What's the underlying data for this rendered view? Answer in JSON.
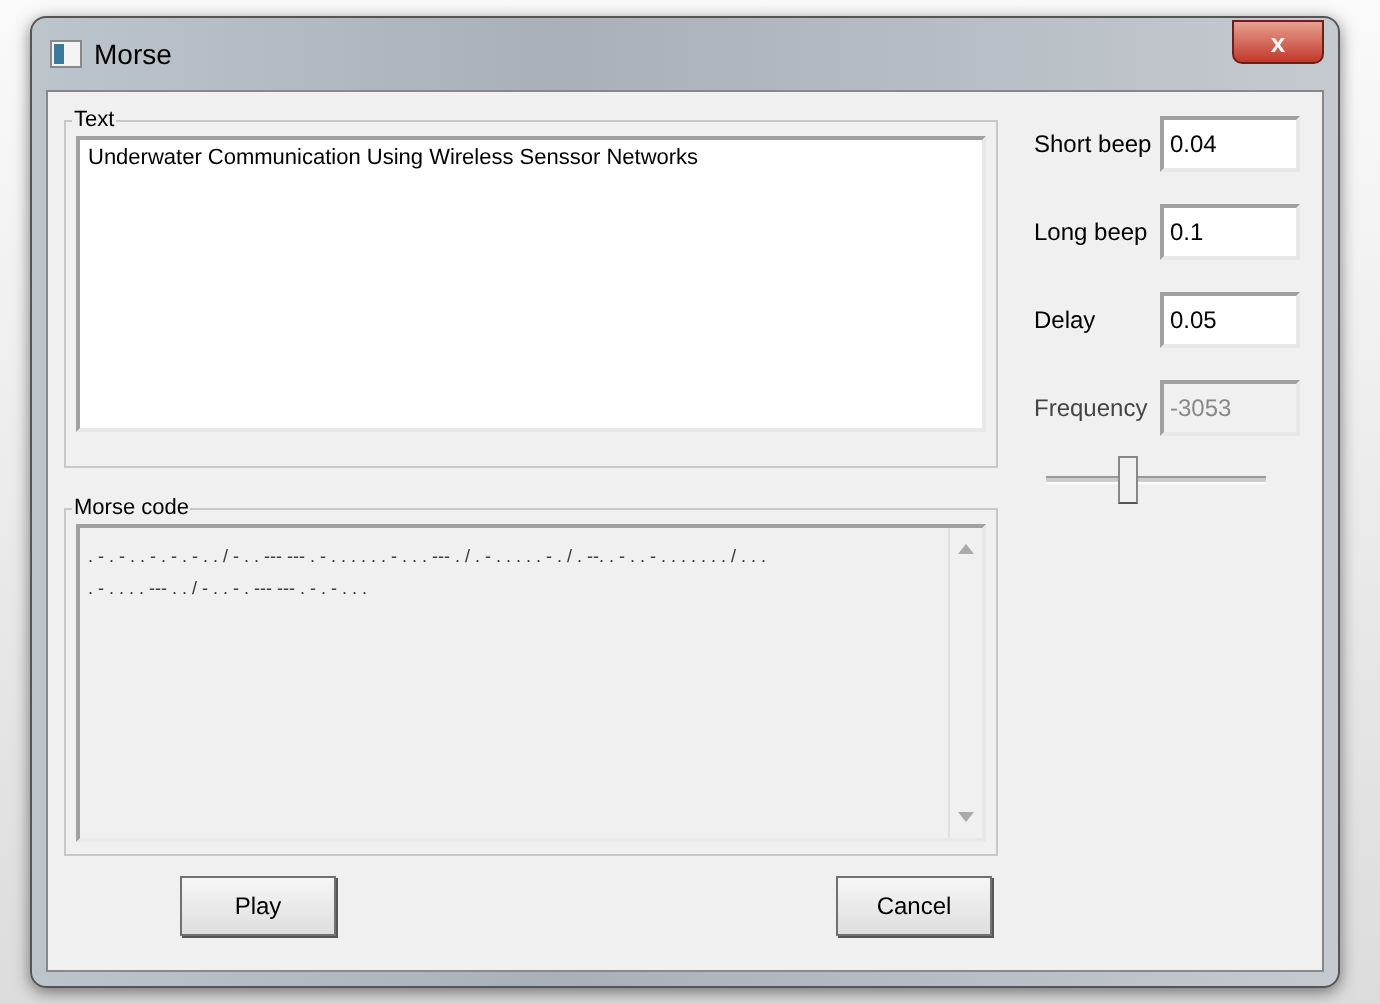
{
  "window": {
    "title": "Morse",
    "close": "x"
  },
  "text_group": {
    "label": "Text",
    "value": "Underwater Communication Using Wireless Senssor Networks"
  },
  "morse_group": {
    "label": "Morse code",
    "value": ". - . - . . - . - . - . . / - . . --- --- . - . . . . . . - . . . --- . / . - . . . . . - . / . --. . - . . - . . . . . . . / . . .\n. - . . . . --- . . / - . . - . --- --- . - . - . . ."
  },
  "settings": [
    {
      "label": "Short beep",
      "value": "0.04",
      "disabled": false
    },
    {
      "label": "Long beep",
      "value": "0.1",
      "disabled": false
    },
    {
      "label": "Delay",
      "value": "0.05",
      "disabled": false
    },
    {
      "label": "Frequency",
      "value": "-3053",
      "disabled": true
    }
  ],
  "slider": {
    "level": 0.36
  },
  "buttons": [
    {
      "label": "Play"
    },
    {
      "label": "Cancel"
    }
  ]
}
